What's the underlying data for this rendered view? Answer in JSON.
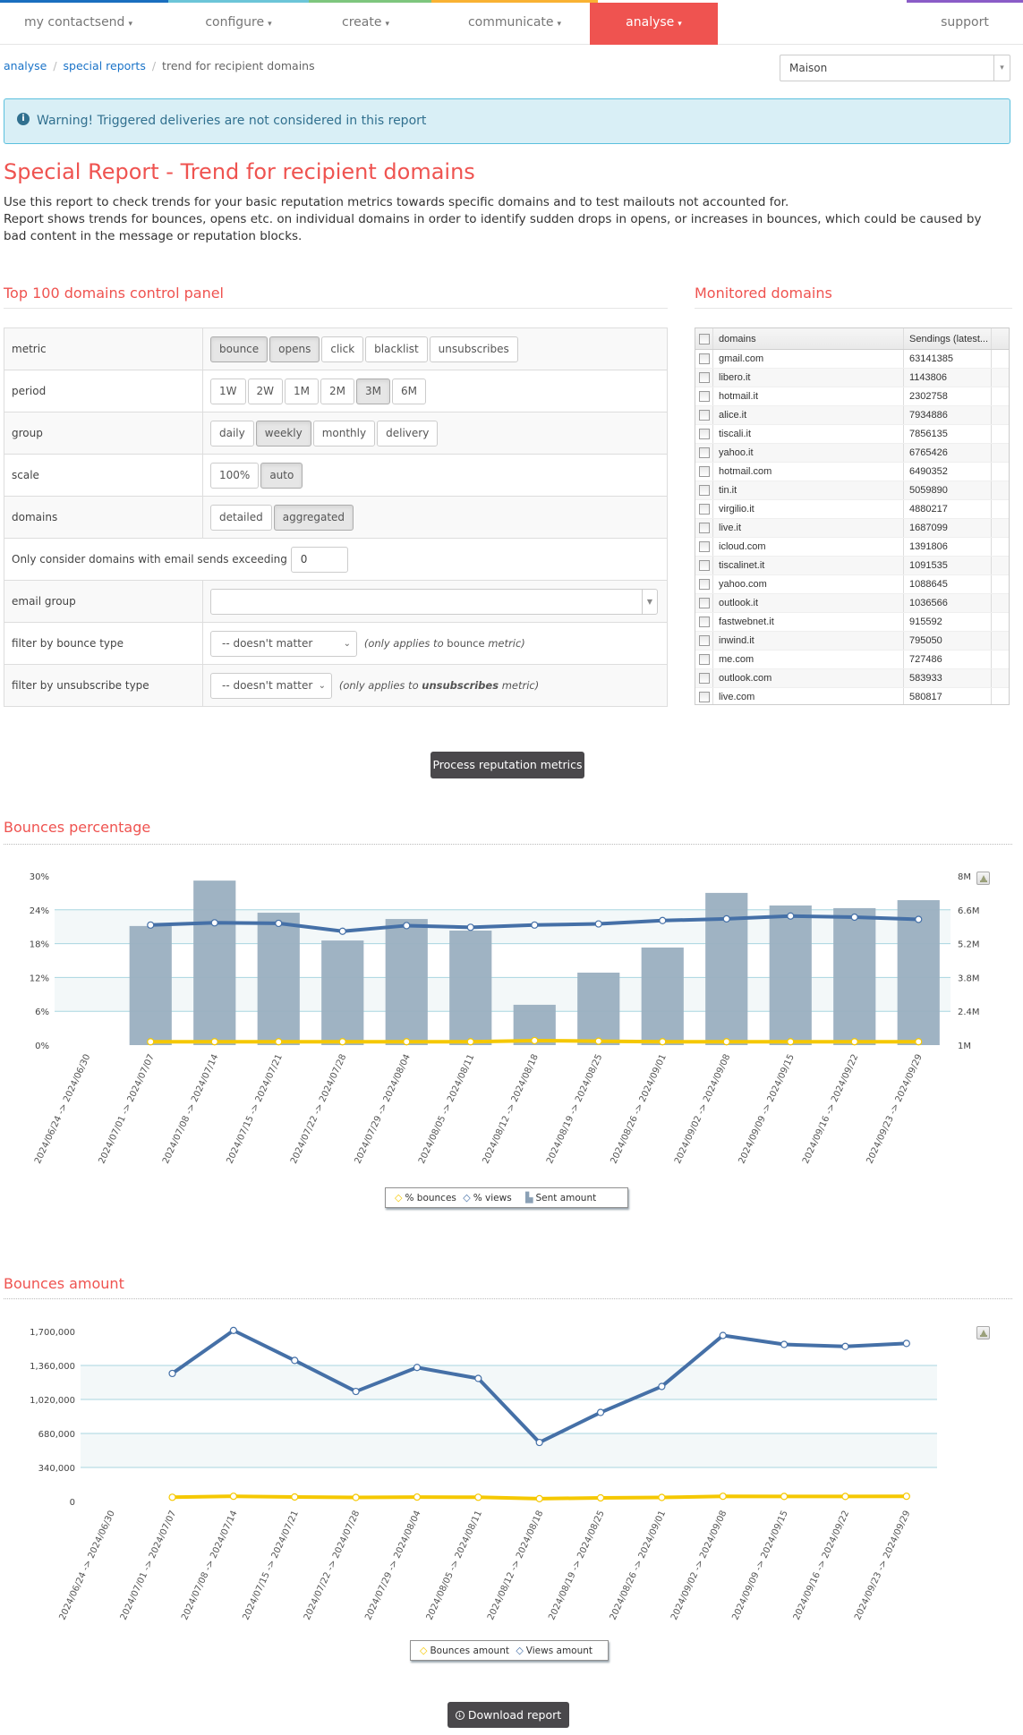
{
  "nav": {
    "items": [
      {
        "label": "my contactsend",
        "caret": true
      },
      {
        "label": "configure",
        "caret": true
      },
      {
        "label": "create",
        "caret": true
      },
      {
        "label": "communicate",
        "caret": true
      },
      {
        "label": "analyse",
        "caret": true,
        "active": true
      },
      {
        "label": "support",
        "caret": false
      }
    ],
    "caret_glyph": "▾",
    "active_color": "#ef5350"
  },
  "breadcrumb": {
    "items": [
      "analyse",
      "special reports",
      "trend for recipient domains"
    ],
    "separator": "/"
  },
  "account_select": {
    "value": "Maison",
    "arrow": "▾"
  },
  "alert": {
    "icon": "info-icon",
    "text": "Warning! Triggered deliveries are not considered in this report"
  },
  "page": {
    "title": "Special Report - Trend for recipient domains",
    "description_line1": "Use this report to check trends for your basic reputation metrics towards specific domains and to test mailouts not accounted for.",
    "description_line2": "Report shows trends for bounces, opens etc. on individual domains in order to identify sudden drops in opens, or increases in bounces, which could be caused by bad content in the message or reputation blocks."
  },
  "control_panel": {
    "title": "Top 100 domains control panel",
    "metric": {
      "label": "metric",
      "options": [
        {
          "label": "bounce",
          "selected": true
        },
        {
          "label": "opens",
          "selected": true
        },
        {
          "label": "click",
          "selected": false
        },
        {
          "label": "blacklist",
          "selected": false
        },
        {
          "label": "unsubscribes",
          "selected": false
        }
      ]
    },
    "period": {
      "label": "period",
      "options": [
        {
          "label": "1W",
          "selected": false
        },
        {
          "label": "2W",
          "selected": false
        },
        {
          "label": "1M",
          "selected": false
        },
        {
          "label": "2M",
          "selected": false
        },
        {
          "label": "3M",
          "selected": true
        },
        {
          "label": "6M",
          "selected": false
        }
      ]
    },
    "group": {
      "label": "group",
      "options": [
        {
          "label": "daily",
          "selected": false
        },
        {
          "label": "weekly",
          "selected": true
        },
        {
          "label": "monthly",
          "selected": false
        },
        {
          "label": "delivery",
          "selected": false
        }
      ]
    },
    "scale": {
      "label": "scale",
      "options": [
        {
          "label": "100%",
          "selected": false
        },
        {
          "label": "auto",
          "selected": true
        }
      ]
    },
    "domains": {
      "label": "domains",
      "options": [
        {
          "label": "detailed",
          "selected": false
        },
        {
          "label": "aggregated",
          "selected": true
        }
      ]
    },
    "min_sends": {
      "label": "Only consider domains with email sends exceeding",
      "value": "0"
    },
    "email_group": {
      "label": "email group",
      "value": ""
    },
    "bounce_type": {
      "label": "filter by bounce type",
      "value": "-- doesn't matter",
      "hint_prefix": "(only applies to",
      "hint_metric": "bounce",
      "hint_suffix": "metric)"
    },
    "unsub_type": {
      "label": "filter by unsubscribe type",
      "value": "-- doesn't matter",
      "hint_prefix": "(only applies to",
      "hint_metric": "unsubscribes",
      "hint_suffix": "metric)"
    }
  },
  "monitored": {
    "title": "Monitored domains",
    "columns": [
      "domains",
      "Sendings (latest..."
    ],
    "rows": [
      {
        "domain": "gmail.com",
        "sendings": "63141385"
      },
      {
        "domain": "libero.it",
        "sendings": "1143806"
      },
      {
        "domain": "hotmail.it",
        "sendings": "2302758"
      },
      {
        "domain": "alice.it",
        "sendings": "7934886"
      },
      {
        "domain": "tiscali.it",
        "sendings": "7856135"
      },
      {
        "domain": "yahoo.it",
        "sendings": "6765426"
      },
      {
        "domain": "hotmail.com",
        "sendings": "6490352"
      },
      {
        "domain": "tin.it",
        "sendings": "5059890"
      },
      {
        "domain": "virgilio.it",
        "sendings": "4880217"
      },
      {
        "domain": "live.it",
        "sendings": "1687099"
      },
      {
        "domain": "icloud.com",
        "sendings": "1391806"
      },
      {
        "domain": "tiscalinet.it",
        "sendings": "1091535"
      },
      {
        "domain": "yahoo.com",
        "sendings": "1088645"
      },
      {
        "domain": "outlook.it",
        "sendings": "1036566"
      },
      {
        "domain": "fastwebnet.it",
        "sendings": "915592"
      },
      {
        "domain": "inwind.it",
        "sendings": "795050"
      },
      {
        "domain": "me.com",
        "sendings": "727486"
      },
      {
        "domain": "outlook.com",
        "sendings": "583933"
      },
      {
        "domain": "live.com",
        "sendings": "580817"
      }
    ]
  },
  "process_button": "Process reputation metrics",
  "download_button": {
    "icon": "download-icon",
    "label": "Download report"
  },
  "chart_data": [
    {
      "type": "bar",
      "title": "Bounces percentage",
      "categories": [
        "2024/06/24 -> 2024/06/30",
        "2024/07/01 -> 2024/07/07",
        "2024/07/08 -> 2024/07/14",
        "2024/07/15 -> 2024/07/21",
        "2024/07/22 -> 2024/07/28",
        "2024/07/29 -> 2024/08/04",
        "2024/08/05 -> 2024/08/11",
        "2024/08/12 -> 2024/08/18",
        "2024/08/19 -> 2024/08/25",
        "2024/08/26 -> 2024/09/01",
        "2024/09/02 -> 2024/09/08",
        "2024/09/09 -> 2024/09/15",
        "2024/09/16 -> 2024/09/22",
        "2024/09/23 -> 2024/09/29"
      ],
      "y_left": {
        "ticks": [
          "0%",
          "6%",
          "12%",
          "18%",
          "24%",
          "30%"
        ],
        "range": [
          0,
          30
        ]
      },
      "y_right": {
        "ticks": [
          "1M",
          "2.4M",
          "3.8M",
          "5.2M",
          "6.6M",
          "8M"
        ],
        "range": [
          1000000,
          8000000
        ]
      },
      "series": [
        {
          "name": "% bounces",
          "kind": "line",
          "axis": "left",
          "color": "#f5c800",
          "values": [
            null,
            0.6,
            0.6,
            0.6,
            0.6,
            0.6,
            0.6,
            0.8,
            0.7,
            0.6,
            0.6,
            0.6,
            0.6,
            0.6
          ]
        },
        {
          "name": "% views",
          "kind": "line",
          "axis": "left",
          "color": "#4570a7",
          "values": [
            null,
            21.3,
            21.7,
            21.6,
            20.2,
            21.2,
            20.9,
            21.3,
            21.5,
            22.1,
            22.4,
            22.9,
            22.7,
            22.3
          ]
        },
        {
          "name": "Sent amount",
          "kind": "bar",
          "axis": "right",
          "color": "#9aafc0",
          "values": [
            null,
            5930000,
            7810000,
            6480000,
            5330000,
            6220000,
            5740000,
            2670000,
            4000000,
            5040000,
            7300000,
            6780000,
            6670000,
            7000000
          ]
        }
      ],
      "legend": [
        "% bounces",
        "% views",
        "Sent amount"
      ],
      "legend_position": "bottom",
      "grid": true
    },
    {
      "type": "line",
      "title": "Bounces amount",
      "categories": [
        "2024/06/24 -> 2024/06/30",
        "2024/07/01 -> 2024/07/07",
        "2024/07/08 -> 2024/07/14",
        "2024/07/15 -> 2024/07/21",
        "2024/07/22 -> 2024/07/28",
        "2024/07/29 -> 2024/08/04",
        "2024/08/05 -> 2024/08/11",
        "2024/08/12 -> 2024/08/18",
        "2024/08/19 -> 2024/08/25",
        "2024/08/26 -> 2024/09/01",
        "2024/09/02 -> 2024/09/08",
        "2024/09/09 -> 2024/09/15",
        "2024/09/16 -> 2024/09/22",
        "2024/09/23 -> 2024/09/29"
      ],
      "y_left": {
        "ticks": [
          "0",
          "340,000",
          "680,000",
          "1,020,000",
          "1,360,000",
          "1,700,000"
        ],
        "range": [
          0,
          1700000
        ]
      },
      "series": [
        {
          "name": "Bounces amount",
          "kind": "line",
          "color": "#f5c800",
          "values": [
            null,
            42000,
            52000,
            45000,
            40000,
            44000,
            42000,
            28000,
            36000,
            40000,
            52000,
            50000,
            50000,
            52000
          ]
        },
        {
          "name": "Views amount",
          "kind": "line",
          "color": "#4570a7",
          "values": [
            null,
            1280000,
            1710000,
            1410000,
            1100000,
            1340000,
            1230000,
            590000,
            890000,
            1150000,
            1660000,
            1570000,
            1550000,
            1580000
          ]
        }
      ],
      "legend": [
        "Bounces amount",
        "Views amount"
      ],
      "legend_position": "bottom",
      "grid": true
    }
  ]
}
